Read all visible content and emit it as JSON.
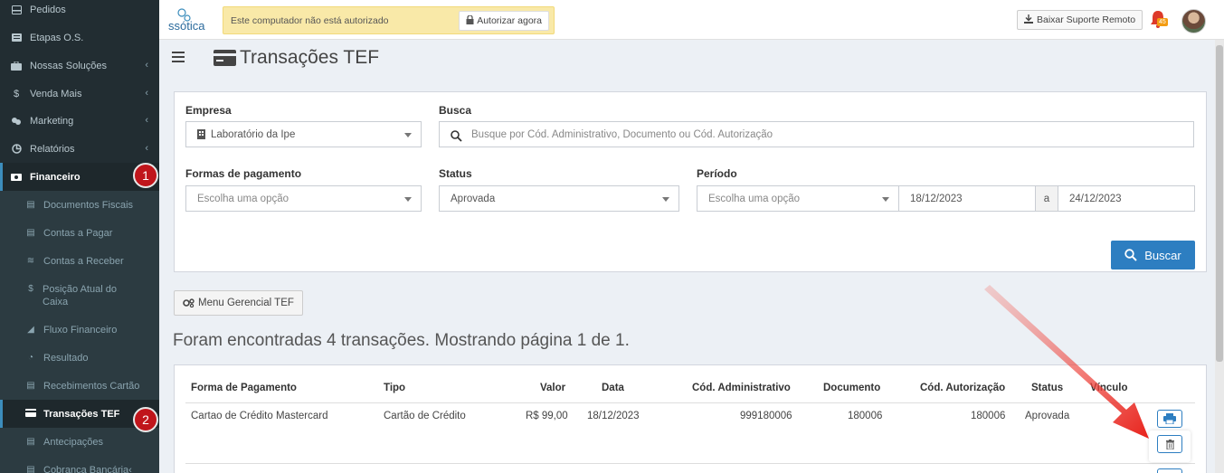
{
  "sidebar": {
    "items": [
      {
        "label": "Pedidos",
        "icon": "inbox-icon"
      },
      {
        "label": "Etapas O.S.",
        "icon": "list-icon"
      },
      {
        "label": "Nossas Soluções",
        "icon": "briefcase-icon"
      },
      {
        "label": "Venda Mais",
        "icon": "dollar-icon"
      },
      {
        "label": "Marketing",
        "icon": "bullhorn-icon"
      },
      {
        "label": "Relatórios",
        "icon": "chart-icon"
      },
      {
        "label": "Financeiro",
        "icon": "money-icon"
      }
    ],
    "sub_items": [
      {
        "label": "Documentos Fiscais",
        "icon": "document-icon"
      },
      {
        "label": "Contas a Pagar",
        "icon": "bill-icon"
      },
      {
        "label": "Contas a Receber",
        "icon": "line-chart-icon"
      },
      {
        "label": "Posição Atual do Caixa",
        "icon": "dollar-icon"
      },
      {
        "label": "Fluxo Financeiro",
        "icon": "area-chart-icon"
      },
      {
        "label": "Resultado",
        "icon": "pie-chart-icon"
      },
      {
        "label": "Recebimentos Cartão",
        "icon": "credit-card-icon"
      },
      {
        "label": "Transações TEF",
        "icon": "credit-card-icon"
      },
      {
        "label": "Antecipações",
        "icon": "credit-card-icon"
      },
      {
        "label": "Cobrança Bancária",
        "icon": "bank-icon"
      }
    ],
    "step_badges": [
      "1",
      "2"
    ]
  },
  "topbar": {
    "logo_text": "ssótica",
    "alert_text": "Este computador não está autorizado",
    "authorize_label": "Autorizar agora",
    "support_label": "Baixar Suporte Remoto",
    "notification_count": "45"
  },
  "page": {
    "title": "Transações TEF"
  },
  "filters": {
    "empresa_label": "Empresa",
    "empresa_value": "Laboratório da Ipe",
    "busca_label": "Busca",
    "busca_placeholder": "Busque por Cód. Administrativo, Documento ou Cód. Autorização",
    "formas_label": "Formas de pagamento",
    "formas_placeholder": "Escolha uma opção",
    "status_label": "Status",
    "status_value": "Aprovada",
    "periodo_label": "Período",
    "periodo_placeholder": "Escolha uma opção",
    "date_from": "18/12/2023",
    "date_sep": "a",
    "date_to": "24/12/2023",
    "search_button": "Buscar"
  },
  "menu_tef_label": "Menu Gerencial TEF",
  "result_summary": "Foram encontradas 4 transações. Mostrando página 1 de 1.",
  "table": {
    "headers": [
      "Forma de Pagamento",
      "Tipo",
      "Valor",
      "Data",
      "Cód. Administrativo",
      "Documento",
      "Cód. Autorização",
      "Status",
      "Vínculo"
    ],
    "rows": [
      [
        "Cartao de Crédito Mastercard",
        "Cartão de Crédito",
        "R$ 99,00",
        "18/12/2023",
        "999180006",
        "180006",
        "180006",
        "Aprovada",
        ""
      ]
    ]
  },
  "colors": {
    "sidebar_bg": "#222d32",
    "accent": "#2d7ec1",
    "badge": "#c0151b",
    "arrow": "#e8221b"
  }
}
